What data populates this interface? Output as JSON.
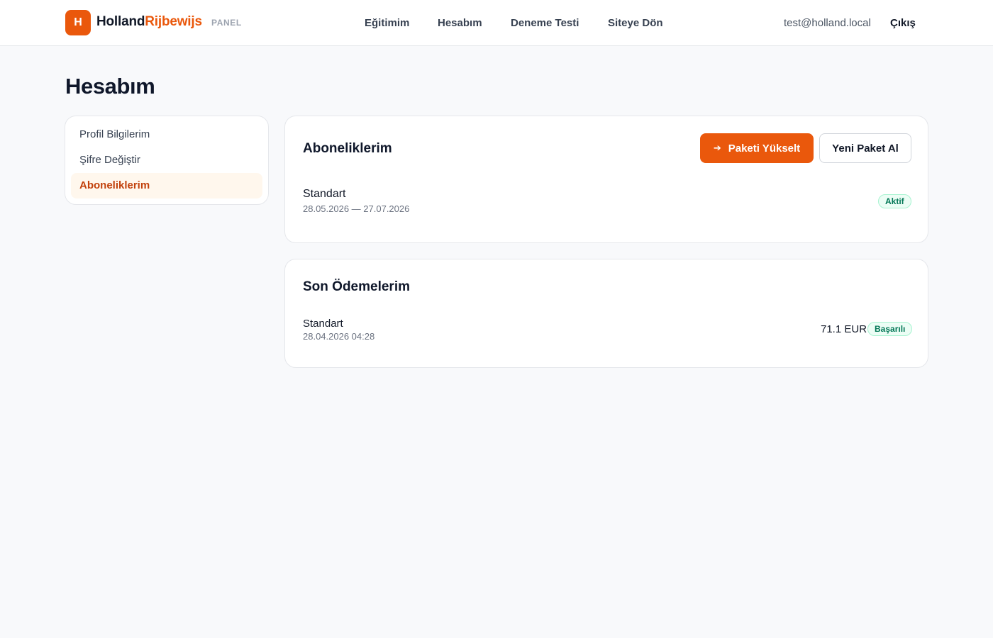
{
  "brand": {
    "logo_letter": "H",
    "name_part1": "Holland",
    "name_part2": "Rijbewijs",
    "tag": "PANEL",
    "accent": "#ea580c"
  },
  "nav": {
    "items": [
      {
        "label": "Eğitimim"
      },
      {
        "label": "Hesabım"
      },
      {
        "label": "Deneme Testi"
      },
      {
        "label": "Siteye Dön"
      }
    ]
  },
  "user": {
    "email": "test@holland.local",
    "logout_label": "Çıkış"
  },
  "page": {
    "title": "Hesabım"
  },
  "sidebar": {
    "items": [
      {
        "label": "Profil Bilgilerim"
      },
      {
        "label": "Şifre Değiştir"
      },
      {
        "label": "Aboneliklerim",
        "active": true
      }
    ]
  },
  "subscriptions": {
    "title": "Aboneliklerim",
    "upgrade_label": "Paketi Yükselt",
    "new_package_label": "Yeni Paket Al",
    "items": [
      {
        "name": "Standart",
        "period": "28.05.2026 — 27.07.2026",
        "status": "Aktif"
      }
    ]
  },
  "payments": {
    "title": "Son Ödemelerim",
    "items": [
      {
        "name": "Standart",
        "datetime": "28.04.2026 04:28",
        "amount": "71.1 EUR",
        "status": "Başarılı"
      }
    ]
  },
  "colors": {
    "accent": "#ea580c",
    "success_bg": "#ecfdf5",
    "success_text": "#047857",
    "active_bg": "#fff7ed",
    "active_text": "#c2410c"
  }
}
